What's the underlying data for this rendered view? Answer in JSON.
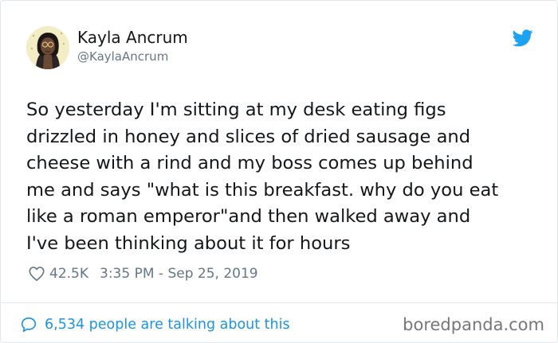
{
  "author": {
    "display_name": "Kayla Ancrum",
    "handle": "@KaylaAncrum"
  },
  "tweet": {
    "text": "So yesterday I'm sitting at my desk eating figs\ndrizzled in honey and slices of dried sausage and\ncheese with a rind and my boss comes up behind\nme and says \"what is this breakfast. why do you eat\nlike a roman emperor\"and then walked away and\nI've been thinking about it for hours",
    "likes": "42.5K",
    "timestamp": "3:35 PM - Sep 25, 2019"
  },
  "footer": {
    "conversation": "6,534 people are talking about this",
    "watermark": "boredpanda.com"
  },
  "icons": {
    "brand": "twitter-bird-icon",
    "like": "heart-icon",
    "reply": "speech-bubble-icon"
  },
  "colors": {
    "brand_blue": "#1da1f2",
    "link_blue": "#1b95e0",
    "muted_gray": "#657786",
    "text_dark": "#14171a"
  }
}
